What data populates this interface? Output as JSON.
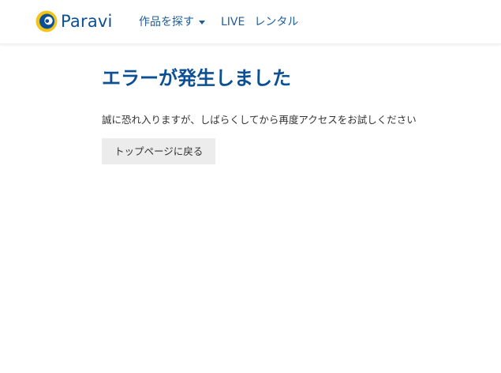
{
  "header": {
    "logo_text": "Paravi",
    "nav": [
      {
        "label": "作品を探す",
        "has_dropdown": true
      },
      {
        "label": "LIVE"
      },
      {
        "label": "レンタル"
      }
    ]
  },
  "main": {
    "title": "エラーが発生しました",
    "message": "誠に恐れ入りますが、しばらくしてから再度アクセスをお試しください",
    "back_button_label": "トップページに戻る"
  },
  "colors": {
    "brand_blue": "#0b4f94",
    "nav_blue": "#1f5c98",
    "logo_yellow": "#f2c318",
    "button_bg": "#ececec"
  },
  "icons": {
    "logo": "paravi-logo-icon",
    "dropdown": "caret-down-icon"
  }
}
